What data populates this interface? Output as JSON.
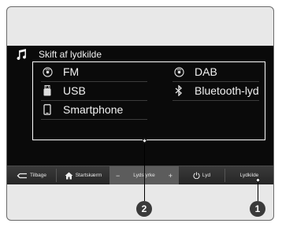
{
  "title": "Skift af lydkilde",
  "sources": [
    {
      "label": "FM",
      "icon": "radio-icon"
    },
    {
      "label": "DAB",
      "icon": "radio-icon"
    },
    {
      "label": "USB",
      "icon": "usb-icon"
    },
    {
      "label": "Bluetooth-lyd",
      "icon": "bluetooth-icon"
    },
    {
      "label": "Smartphone",
      "icon": "smartphone-icon"
    }
  ],
  "bottom_bar": {
    "back": "Tilbage",
    "home": "Startskærm",
    "volume_minus": "−",
    "volume": "Lydstyrke",
    "volume_plus": "+",
    "sound": "Lyd",
    "source": "Lydkilde"
  },
  "callouts": {
    "one": "1",
    "two": "2"
  },
  "colors": {
    "screen": "#0a0a0a",
    "text": "#f2f2f2",
    "bar": "#2e2e2e",
    "volume_bg": "#5c5c5c"
  }
}
